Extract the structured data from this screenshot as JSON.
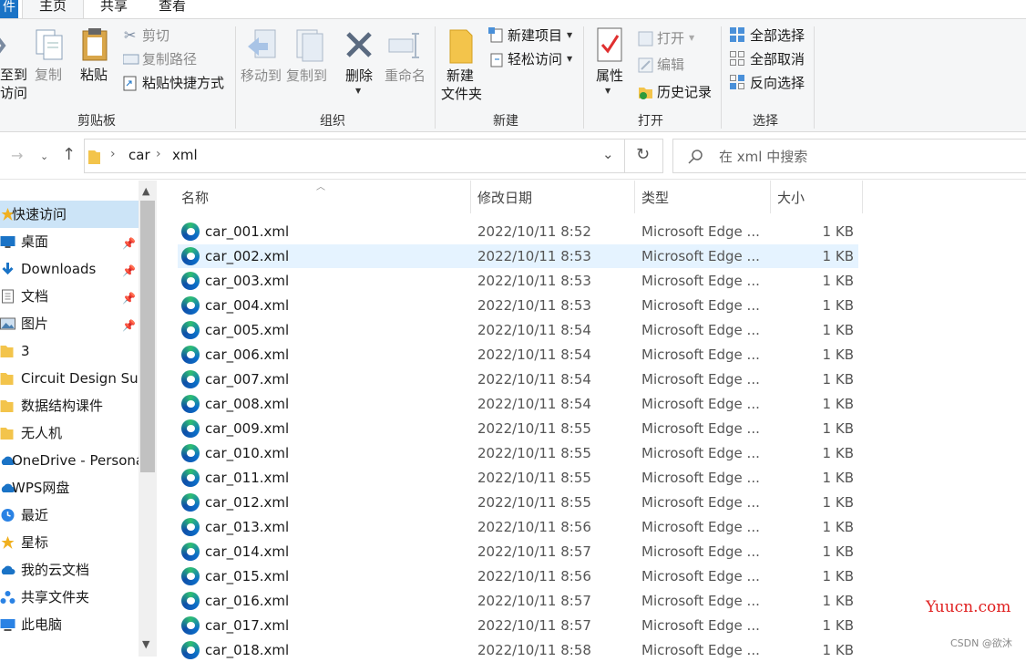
{
  "tabs": {
    "file": "件",
    "home": "主页",
    "share": "共享",
    "view": "查看"
  },
  "ribbon": {
    "pin_quick_access": [
      "至到",
      "访问"
    ],
    "copy": "复制",
    "paste": "粘贴",
    "cut": "剪切",
    "copy_path": "复制路径",
    "paste_shortcut": "粘贴快捷方式",
    "clipboard_group": "剪贴板",
    "move_to": "移动到",
    "copy_to": "复制到",
    "delete": "删除",
    "rename": "重命名",
    "organize_group": "组织",
    "new_folder": [
      "新建",
      "文件夹"
    ],
    "new_item": "新建项目",
    "easy_access": "轻松访问",
    "new_group": "新建",
    "properties": "属性",
    "open": "打开",
    "edit": "编辑",
    "history": "历史记录",
    "open_group": "打开",
    "select_all": "全部选择",
    "select_none": "全部取消",
    "invert_selection": "反向选择",
    "select_group": "选择"
  },
  "address": {
    "crumbs": [
      "car",
      "xml"
    ],
    "search_placeholder": "在 xml 中搜索"
  },
  "nav": [
    {
      "label": "快速访问",
      "icon": "star-icon",
      "pinned": false,
      "selected": true
    },
    {
      "label": "桌面",
      "icon": "desktop-icon",
      "pinned": true
    },
    {
      "label": "Downloads",
      "icon": "download-icon",
      "pinned": true
    },
    {
      "label": "文档",
      "icon": "document-icon",
      "pinned": true
    },
    {
      "label": "图片",
      "icon": "picture-icon",
      "pinned": true
    },
    {
      "label": "3",
      "icon": "folder-icon",
      "pinned": false
    },
    {
      "label": "Circuit Design Sui",
      "icon": "folder-icon",
      "pinned": false
    },
    {
      "label": "数据结构课件",
      "icon": "folder-icon",
      "pinned": false
    },
    {
      "label": "无人机",
      "icon": "folder-icon",
      "pinned": false
    },
    {
      "label": "OneDrive - Persona",
      "icon": "cloud-icon",
      "pinned": false
    },
    {
      "label": "WPS网盘",
      "icon": "cloud-icon",
      "pinned": false
    },
    {
      "label": "最近",
      "icon": "clock-icon",
      "pinned": false
    },
    {
      "label": "星标",
      "icon": "star-icon",
      "pinned": false
    },
    {
      "label": "我的云文档",
      "icon": "cloud-icon",
      "pinned": false
    },
    {
      "label": "共享文件夹",
      "icon": "share-icon",
      "pinned": false
    },
    {
      "label": "此电脑",
      "icon": "computer-icon",
      "pinned": false
    }
  ],
  "columns": {
    "name": "名称",
    "date": "修改日期",
    "type": "类型",
    "size": "大小"
  },
  "files": [
    {
      "name": "car_001.xml",
      "date": "2022/10/11 8:52",
      "type": "Microsoft Edge ...",
      "size": "1 KB"
    },
    {
      "name": "car_002.xml",
      "date": "2022/10/11 8:53",
      "type": "Microsoft Edge ...",
      "size": "1 KB"
    },
    {
      "name": "car_003.xml",
      "date": "2022/10/11 8:53",
      "type": "Microsoft Edge ...",
      "size": "1 KB"
    },
    {
      "name": "car_004.xml",
      "date": "2022/10/11 8:53",
      "type": "Microsoft Edge ...",
      "size": "1 KB"
    },
    {
      "name": "car_005.xml",
      "date": "2022/10/11 8:54",
      "type": "Microsoft Edge ...",
      "size": "1 KB"
    },
    {
      "name": "car_006.xml",
      "date": "2022/10/11 8:54",
      "type": "Microsoft Edge ...",
      "size": "1 KB"
    },
    {
      "name": "car_007.xml",
      "date": "2022/10/11 8:54",
      "type": "Microsoft Edge ...",
      "size": "1 KB"
    },
    {
      "name": "car_008.xml",
      "date": "2022/10/11 8:54",
      "type": "Microsoft Edge ...",
      "size": "1 KB"
    },
    {
      "name": "car_009.xml",
      "date": "2022/10/11 8:55",
      "type": "Microsoft Edge ...",
      "size": "1 KB"
    },
    {
      "name": "car_010.xml",
      "date": "2022/10/11 8:55",
      "type": "Microsoft Edge ...",
      "size": "1 KB"
    },
    {
      "name": "car_011.xml",
      "date": "2022/10/11 8:55",
      "type": "Microsoft Edge ...",
      "size": "1 KB"
    },
    {
      "name": "car_012.xml",
      "date": "2022/10/11 8:55",
      "type": "Microsoft Edge ...",
      "size": "1 KB"
    },
    {
      "name": "car_013.xml",
      "date": "2022/10/11 8:56",
      "type": "Microsoft Edge ...",
      "size": "1 KB"
    },
    {
      "name": "car_014.xml",
      "date": "2022/10/11 8:57",
      "type": "Microsoft Edge ...",
      "size": "1 KB"
    },
    {
      "name": "car_015.xml",
      "date": "2022/10/11 8:56",
      "type": "Microsoft Edge ...",
      "size": "1 KB"
    },
    {
      "name": "car_016.xml",
      "date": "2022/10/11 8:57",
      "type": "Microsoft Edge ...",
      "size": "1 KB"
    },
    {
      "name": "car_017.xml",
      "date": "2022/10/11 8:57",
      "type": "Microsoft Edge ...",
      "size": "1 KB"
    },
    {
      "name": "car_018.xml",
      "date": "2022/10/11 8:58",
      "type": "Microsoft Edge ...",
      "size": "1 KB"
    }
  ],
  "hovered_row": 1,
  "watermark": {
    "site": "Yuucn.com",
    "author": "CSDN @欲沐"
  }
}
